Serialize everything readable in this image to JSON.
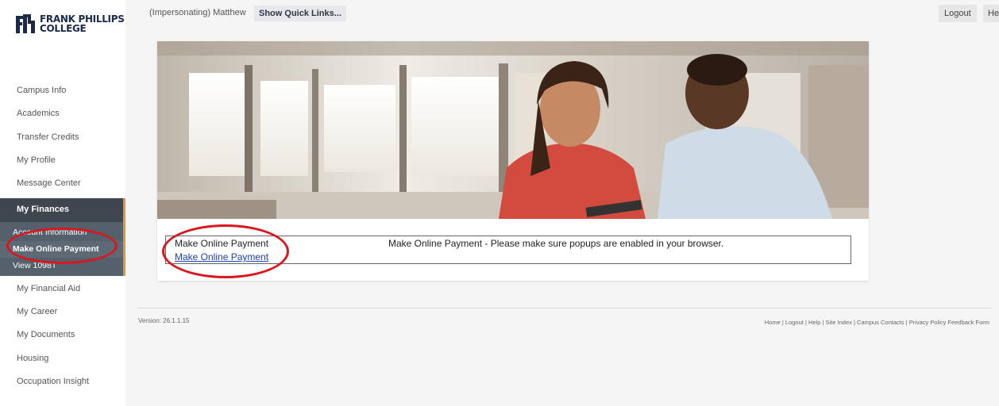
{
  "header": {
    "impersonating": "(Impersonating) Matthew",
    "quick_links": "Show Quick Links...",
    "logout": "Logout",
    "help": "Hel"
  },
  "logo": {
    "line1": "FRANK PHILLIPS",
    "line2": "COLLEGE"
  },
  "sidebar": {
    "items_before": [
      "Campus Info",
      "Academics",
      "Transfer Credits",
      "My Profile",
      "Message Center"
    ],
    "active": "My Finances",
    "sub_items": [
      "Account Information",
      "Make Online Payment",
      "View 1098T"
    ],
    "items_after": [
      "My Financial Aid",
      "My Career",
      "My Documents",
      "Housing",
      "Occupation Insight"
    ]
  },
  "payment": {
    "title": "Make Online Payment",
    "link": "Make Online Payment",
    "message": "Make Online Payment - Please make sure popups are enabled in your browser."
  },
  "footer": {
    "version": "Version: 26.1.1.15",
    "links": "Home | Logout | Help | Site Index | Campus Contacts | Privacy Policy Feedback Form"
  },
  "colors": {
    "accent": "#e8952f",
    "nav_dark": "#3f464f",
    "annotation_red": "#d8171e",
    "link": "#1a3fa8"
  }
}
